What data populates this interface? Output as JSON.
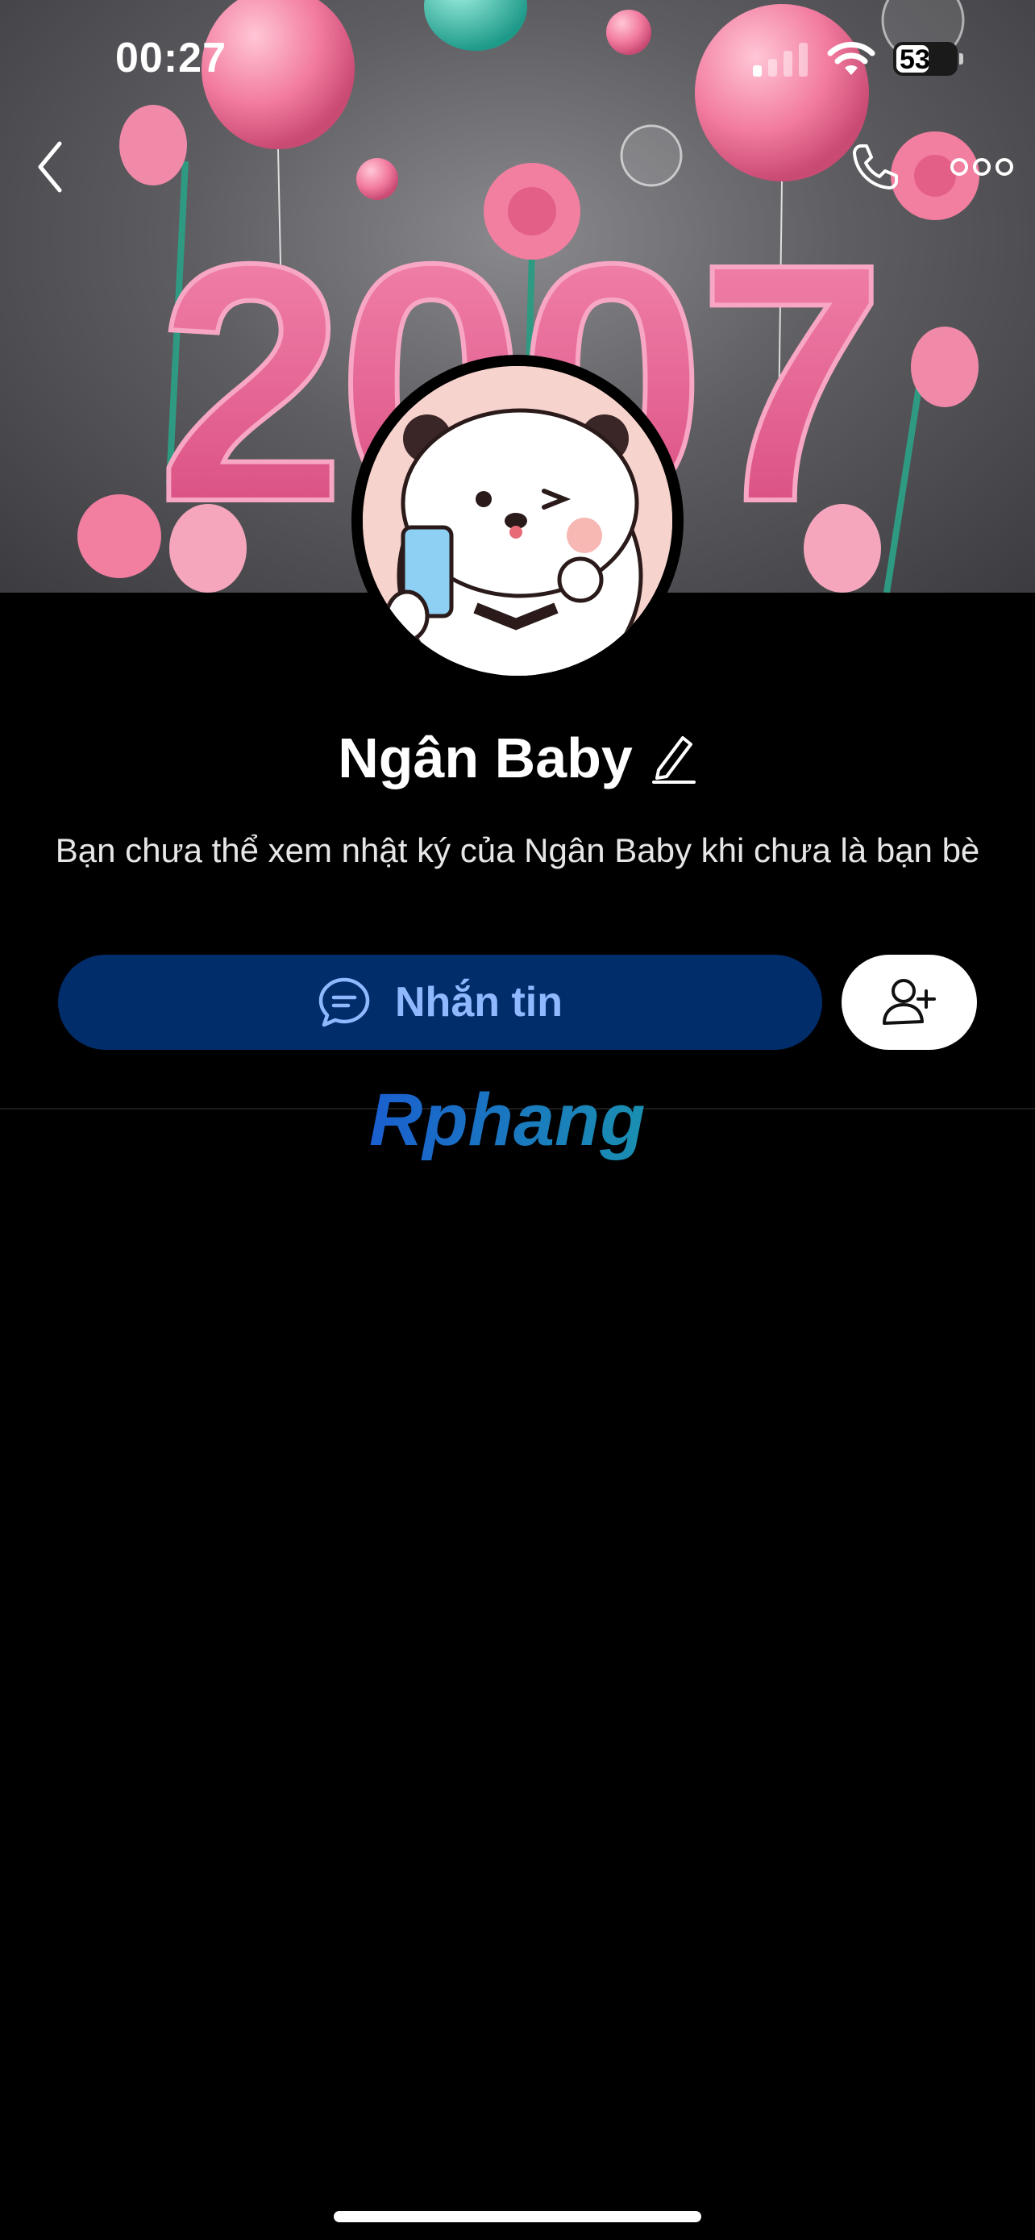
{
  "status_bar": {
    "time": "00:27",
    "battery": "53",
    "signal_icon": "cellular-signal-icon",
    "wifi_icon": "wifi-icon"
  },
  "cover": {
    "year_text": "2007"
  },
  "header": {
    "back_icon": "chevron-left-icon",
    "call_icon": "phone-icon",
    "more_icon": "more-dots-icon"
  },
  "profile": {
    "name": "Ngân Baby",
    "edit_icon": "pencil-icon",
    "notice": "Bạn chưa thể xem nhật ký của Ngân Baby khi chưa là bạn bè"
  },
  "actions": {
    "message_label": "Nhắn tin",
    "message_icon": "chat-bubble-icon",
    "add_friend_icon": "add-friend-icon"
  },
  "watermark": {
    "text": "Rphang"
  },
  "colors": {
    "message_button_bg": "#022d6b",
    "message_button_text": "#8fb8ff",
    "background": "#000000"
  }
}
